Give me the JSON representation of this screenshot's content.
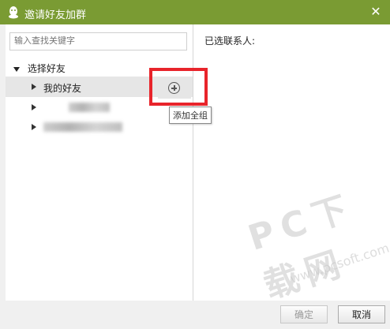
{
  "window": {
    "title": "邀请好友加群",
    "close_glyph": "✕"
  },
  "search": {
    "placeholder": "输入查找关键字"
  },
  "tree": {
    "root_label": "选择好友",
    "groups": [
      {
        "label": "我的好友",
        "selected": true
      },
      {
        "label": "",
        "selected": false
      },
      {
        "label": "",
        "selected": false
      }
    ]
  },
  "add_button": {
    "tooltip": "添加全组"
  },
  "selected_panel": {
    "label": "已选联系人:"
  },
  "buttons": {
    "confirm": "确定",
    "cancel": "取消"
  },
  "watermark": {
    "text": "PC下载网",
    "subtext": "www.pcsoft.com.cn"
  },
  "colors": {
    "titlebar": "#7a9b33",
    "highlight": "#e8242b"
  }
}
